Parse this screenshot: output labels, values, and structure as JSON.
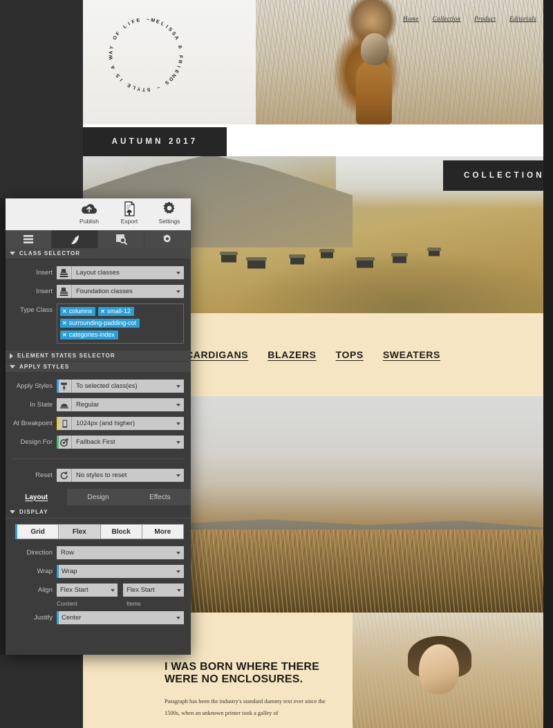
{
  "website": {
    "logo_text": "MELISSA & FRIENDS ~ STYLE IS A WAY OF LIFE ~",
    "nav": [
      {
        "label": "Home"
      },
      {
        "label": "Collection"
      },
      {
        "label": "Product"
      },
      {
        "label": "Editorials"
      }
    ],
    "season_banner": "AUTUMN 2017",
    "collection_banner": "COLLECTION",
    "categories": [
      {
        "label": "CARDIGANS"
      },
      {
        "label": "BLAZERS"
      },
      {
        "label": "TOPS"
      },
      {
        "label": "SWEATERS"
      }
    ],
    "article": {
      "title": "I WAS BORN WHERE THERE WERE NO ENCLOSURES.",
      "paragraph": "Paragraph has been the industry's standard dummy text ever since the 1500s, when an unknown printer took a galley of"
    }
  },
  "editor": {
    "toolbar": [
      {
        "label": "Publish",
        "icon": "cloud-upload-icon"
      },
      {
        "label": "Export",
        "icon": "document-export-icon"
      },
      {
        "label": "Settings",
        "icon": "gear-icon"
      }
    ],
    "tabs": [
      {
        "name": "list",
        "icon": "hamburger-icon",
        "active": false
      },
      {
        "name": "style",
        "icon": "pen-icon",
        "active": true
      },
      {
        "name": "inspect",
        "icon": "magnifier-box-icon",
        "active": false
      },
      {
        "name": "settings",
        "icon": "gear-icon",
        "active": false
      }
    ],
    "sections": {
      "class_selector": {
        "title": "CLASS SELECTOR",
        "expanded": true
      },
      "element_states": {
        "title": "ELEMENT STATES SELECTOR",
        "expanded": false
      },
      "apply_styles": {
        "title": "APPLY STYLES",
        "expanded": true
      },
      "display": {
        "title": "DISPLAY",
        "expanded": true
      }
    },
    "class_selector": {
      "insert_layout": {
        "label": "Insert",
        "value": "Layout classes",
        "icon": "stamp-icon"
      },
      "insert_foundation": {
        "label": "Insert",
        "value": "Foundation classes",
        "icon": "stamp-icon"
      },
      "type_class_label": "Type Class",
      "classes": [
        {
          "name": "columns"
        },
        {
          "name": "small-12"
        },
        {
          "name": "surrounding-padding-col"
        },
        {
          "name": "categories-index"
        }
      ]
    },
    "apply_styles": {
      "apply_styles": {
        "label": "Apply Styles",
        "value": "To selected class(es)",
        "icon": "paint-roller-icon",
        "accent": "#2aa4df"
      },
      "in_state": {
        "label": "In State",
        "value": "Regular",
        "icon": "state-icon",
        "accent": ""
      },
      "at_breakpoint": {
        "label": "At Breakpoint",
        "value": "1024px (and higher)",
        "icon": "breakpoint-icon",
        "accent": "#e8d21e"
      },
      "design_for": {
        "label": "Design For",
        "value": "Fallback First",
        "icon": "target-icon",
        "accent": "#43c16a"
      },
      "reset": {
        "label": "Reset",
        "value": "No styles to reset",
        "icon": "reset-icon",
        "accent": ""
      }
    },
    "style_tabs": [
      {
        "label": "Layout",
        "active": true
      },
      {
        "label": "Design",
        "active": false
      },
      {
        "label": "Effects",
        "active": false
      }
    ],
    "display": {
      "modes": [
        {
          "label": "Grid",
          "active": false
        },
        {
          "label": "Flex",
          "active": true
        },
        {
          "label": "Block",
          "active": false
        },
        {
          "label": "More",
          "active": false
        }
      ],
      "direction": {
        "label": "Direction",
        "value": "Row",
        "accent": ""
      },
      "wrap": {
        "label": "Wrap",
        "value": "Wrap",
        "accent": "#2aa4df"
      },
      "align": {
        "label": "Align",
        "content": {
          "value": "Flex Start",
          "caption": "Content"
        },
        "items": {
          "value": "Flex Start",
          "caption": "Items"
        }
      },
      "justify": {
        "label": "Justify",
        "value": "Center",
        "accent": "#2aa4df"
      }
    }
  },
  "colors": {
    "accent_blue": "#2aa4df",
    "accent_yellow": "#e8d21e",
    "accent_green": "#43c16a",
    "panel_bg": "#3c3c3c",
    "desktop_bg": "#2e2e2e",
    "beige": "#f6e5c2",
    "banner_dark": "#262626"
  }
}
